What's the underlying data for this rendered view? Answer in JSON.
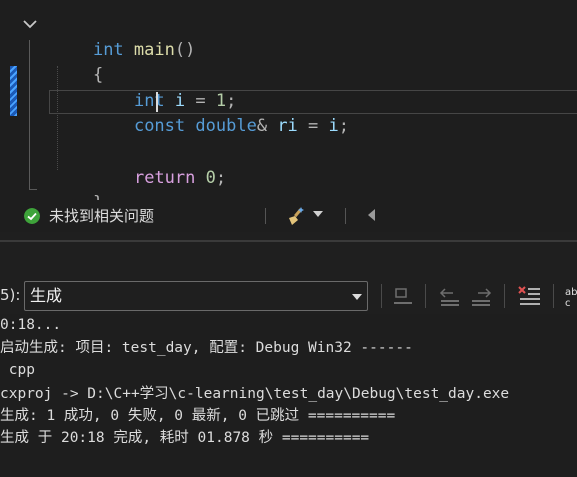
{
  "editor": {
    "line1": {
      "kw": "int",
      "fn": "main",
      "parens": "()"
    },
    "line2": "{",
    "line3": {
      "kw": "int",
      "var": "i",
      "eq": "=",
      "num": "1",
      "semi": ";"
    },
    "line4": {
      "kw": "const",
      "kw2": "double",
      "amp": "&",
      "var": "ri",
      "eq": "=",
      "var2": "i",
      "semi": ";"
    },
    "line6": {
      "kw": "return",
      "num": "0",
      "semi": ";"
    },
    "line7": "}"
  },
  "status": {
    "icon": "check-circle-icon",
    "text": "未找到相关问题"
  },
  "output_toolbar": {
    "source_label": "5):",
    "source_value": "生成"
  },
  "output": {
    "lines": [
      "0:18...",
      "启动生成: 项目: test_day, 配置: Debug Win32 ------",
      " cpp",
      "cxproj -> D:\\C++学习\\c-learning\\test_day\\Debug\\test_day.exe",
      "生成: 1 成功, 0 失败, 0 最新, 0 已跳过 ==========",
      "生成 于 20:18 完成, 耗时 01.878 秒 =========="
    ]
  },
  "colors": {
    "background": "#1e1e1e",
    "keyword": "#569cd6",
    "function": "#dcdcaa",
    "variable": "#9cdcfe",
    "number": "#b5cea8",
    "control": "#d8a0df",
    "success": "#3ea33a"
  }
}
